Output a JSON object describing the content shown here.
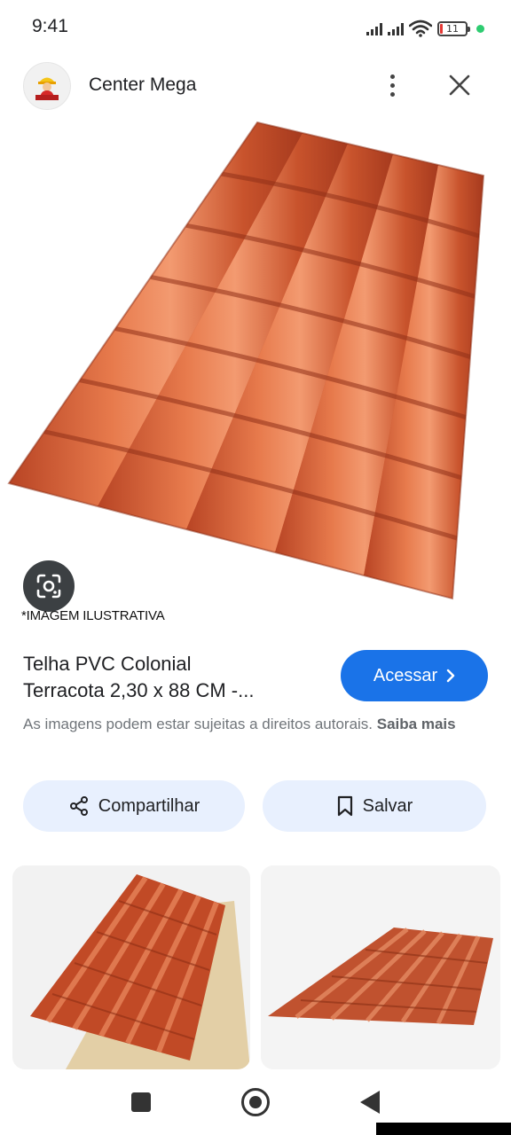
{
  "status_bar": {
    "time": "9:41",
    "battery_level": "11",
    "icons": [
      "signal-icon",
      "signal-icon",
      "wifi-icon",
      "battery-icon",
      "notification-dot"
    ],
    "dot_color": "#2ecc71"
  },
  "header": {
    "site_name": "Center Mega",
    "logo_icon": "site-logo-icon",
    "more_icon": "more-vertical-icon",
    "close_icon": "close-icon"
  },
  "image": {
    "caption": "*IMAGEM ILUSTRATIVA",
    "lens_icon": "google-lens-icon",
    "tile_color": "#c9542c"
  },
  "result": {
    "title_line1": "Telha PVC Colonial",
    "title_line2": "Terracota 2,30 x 88 CM -...",
    "visit_label": "Acessar",
    "copyright_text": "As imagens podem estar sujeitas a direitos autorais.",
    "learn_more": "Saiba mais"
  },
  "actions": {
    "share_label": "Compartilhar",
    "save_label": "Salvar"
  },
  "colors": {
    "accent": "#1a73e8",
    "chip_background": "#e8f0fe"
  },
  "nav": {
    "icons": [
      "recent-apps-icon",
      "home-icon",
      "back-icon"
    ]
  }
}
